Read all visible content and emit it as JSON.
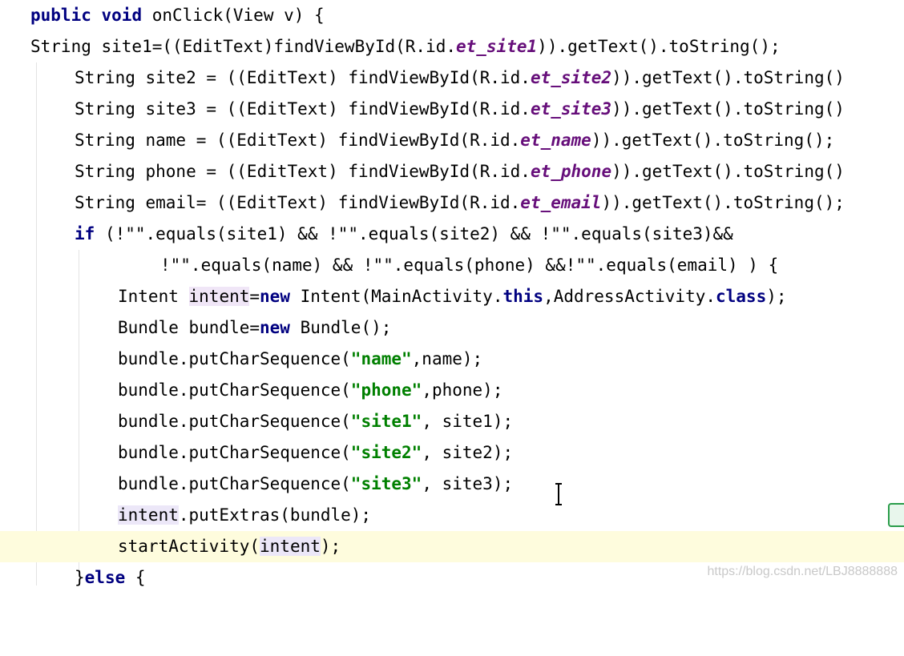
{
  "editor": {
    "line1": [
      "public",
      "void",
      "onClick(View v) {"
    ],
    "line2": [
      "String site1=((EditText)findViewById(R.id.",
      "et_site1",
      ")).getText().toString();"
    ],
    "line3": [
      "String site2 = ((EditText) findViewById(R.id.",
      "et_site2",
      ")).getText().toString()"
    ],
    "line4": [
      "String site3 = ((EditText) findViewById(R.id.",
      "et_site3",
      ")).getText().toString()"
    ],
    "line5": [
      "String name = ((EditText) findViewById(R.id.",
      "et_name",
      ")).getText().toString();"
    ],
    "line6": [
      "String phone = ((EditText) findViewById(R.id.",
      "et_phone",
      ")).getText().toString()"
    ],
    "line7": [
      "String email= ((EditText) findViewById(R.id.",
      "et_email",
      ")).getText().toString();"
    ],
    "line8": [
      "if",
      "(!\"\".equals(site1) && !\"\".equals(site2) && !\"\".equals(site3)&&"
    ],
    "line9": [
      "!\"\".equals(name) && !\"\".equals(phone) &&!\"\".equals(email) ) {"
    ],
    "line10": [
      "Intent ",
      "intent",
      "=",
      "new",
      " Intent(MainActivity.",
      "this",
      ",AddressActivity.",
      "class",
      ");"
    ],
    "line11": [
      "Bundle bundle=",
      "new",
      " Bundle();"
    ],
    "line12": [
      "bundle.putCharSequence(",
      "\"name\"",
      ",name);"
    ],
    "line13": [
      "bundle.putCharSequence(",
      "\"phone\"",
      ",phone);"
    ],
    "line14": [
      "bundle.putCharSequence(",
      "\"site1\"",
      ", site1);"
    ],
    "line15": [
      "bundle.putCharSequence(",
      "\"site2\"",
      ", site2);"
    ],
    "line16": [
      "bundle.putCharSequence(",
      "\"site3\"",
      ", site3);"
    ],
    "line17": [
      "intent",
      ".putExtras(bundle);"
    ],
    "line18": [
      "startActivity(",
      "intent",
      ");"
    ],
    "line19": [
      "}",
      "else",
      " {"
    ]
  },
  "watermark": "https://blog.csdn.net/LBJ8888888",
  "colors": {
    "keyword": "#000080",
    "field": "#660e7a",
    "string": "#008000",
    "current_line": "#fefcdd"
  },
  "icons": {
    "caret": "text-cursor-icon",
    "gutter": "spellcheck-icon"
  }
}
